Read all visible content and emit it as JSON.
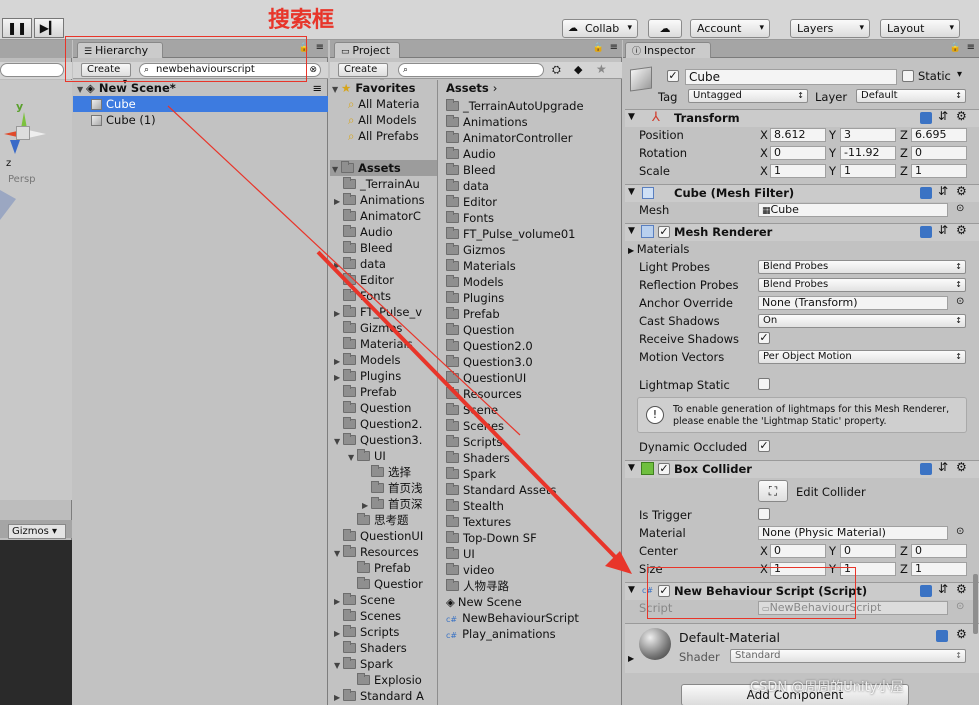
{
  "annotation": {
    "text": "搜索框"
  },
  "toolbar": {
    "collab": "Collab",
    "account": "Account",
    "layers": "Layers",
    "layout": "Layout"
  },
  "scene": {
    "persp": "Persp",
    "y": "y",
    "z": "z",
    "gizmos": "Gizmos"
  },
  "hierarchy": {
    "tab": "Hierarchy",
    "create": "Create",
    "search": "newbehaviourscript",
    "scene_name": "New Scene*",
    "items": [
      "Cube",
      "Cube (1)"
    ]
  },
  "project": {
    "tab": "Project",
    "create": "Create",
    "favorites": "Favorites",
    "fav_items": [
      "All Materia",
      "All Models",
      "All Prefabs"
    ],
    "assets_header": "Assets",
    "tree": [
      "_TerrainAu",
      "Animations",
      "AnimatorC",
      "Audio",
      "Bleed",
      "data",
      "Editor",
      "Fonts",
      "FT_Pulse_v",
      "Gizmos",
      "Materials",
      "Models",
      "Plugins",
      "Prefab",
      "Question",
      "Question2.",
      "Question3.",
      "UI",
      "选择",
      "首页浅",
      "首页深",
      "思考题",
      "QuestionUI",
      "Resources",
      "Prefab",
      "Questior",
      "Scene",
      "Scenes",
      "Scripts",
      "Shaders",
      "Spark",
      "Explosio",
      "Standard A"
    ],
    "breadcrumb": "Assets",
    "list": [
      "_TerrainAutoUpgrade",
      "Animations",
      "AnimatorController",
      "Audio",
      "Bleed",
      "data",
      "Editor",
      "Fonts",
      "FT_Pulse_volume01",
      "Gizmos",
      "Materials",
      "Models",
      "Plugins",
      "Prefab",
      "Question",
      "Question2.0",
      "Question3.0",
      "QuestionUI",
      "Resources",
      "Scene",
      "Scenes",
      "Scripts",
      "Shaders",
      "Spark",
      "Standard Assets",
      "Stealth",
      "Textures",
      "Top-Down SF",
      "UI",
      "video",
      "人物寻路",
      "New Scene",
      "NewBehaviourScript",
      "Play_animations"
    ]
  },
  "inspector": {
    "tab": "Inspector",
    "name": "Cube",
    "static": "Static",
    "tag_label": "Tag",
    "tag": "Untagged",
    "layer_label": "Layer",
    "layer": "Default",
    "transform": {
      "title": "Transform",
      "position": "Position",
      "rotation": "Rotation",
      "scale": "Scale",
      "px": "8.612",
      "py": "3",
      "pz": "6.695",
      "rx": "0",
      "ry": "-11.92",
      "rz": "0",
      "sx": "1",
      "sy": "1",
      "sz": "1",
      "X": "X",
      "Y": "Y",
      "Z": "Z"
    },
    "meshfilter": {
      "title": "Cube (Mesh Filter)",
      "mesh_label": "Mesh",
      "mesh": "Cube"
    },
    "renderer": {
      "title": "Mesh Renderer",
      "materials": "Materials",
      "light_probes": "Light Probes",
      "light_probes_val": "Blend Probes",
      "reflection": "Reflection Probes",
      "reflection_val": "Blend Probes",
      "anchor": "Anchor Override",
      "anchor_val": "None (Transform)",
      "cast": "Cast Shadows",
      "cast_val": "On",
      "receive": "Receive Shadows",
      "motion": "Motion Vectors",
      "motion_val": "Per Object Motion",
      "lightmap": "Lightmap Static",
      "info": "To enable generation of lightmaps for this Mesh Renderer, please enable the 'Lightmap Static' property.",
      "dynamic": "Dynamic Occluded"
    },
    "collider": {
      "title": "Box Collider",
      "edit": "Edit Collider",
      "trigger": "Is Trigger",
      "material_label": "Material",
      "material": "None (Physic Material)",
      "center": "Center",
      "cx": "0",
      "cy": "0",
      "cz": "0",
      "size": "Size",
      "szx": "1",
      "szy": "1",
      "szz": "1"
    },
    "script": {
      "title": "New Behaviour Script (Script)",
      "label": "Script",
      "value": "NewBehaviourScript"
    },
    "material": {
      "name": "Default-Material",
      "shader_label": "Shader",
      "shader": "Standard"
    },
    "add_component": "Add Component"
  },
  "watermark": "CSDN @周周的Unity小屋"
}
